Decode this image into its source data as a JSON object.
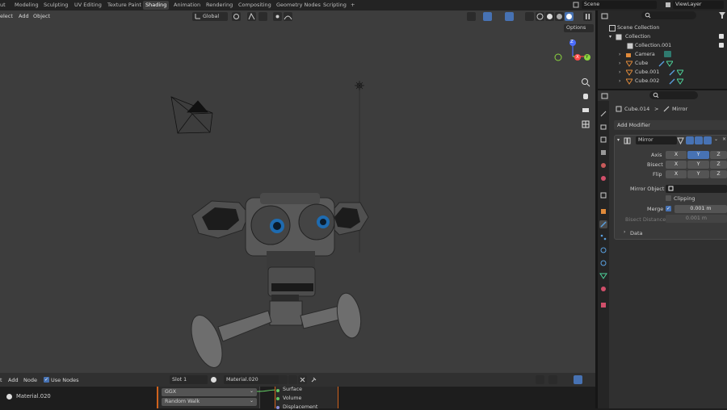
{
  "workspaces": [
    "ut",
    "Modeling",
    "Sculpting",
    "UV Editing",
    "Texture Paint",
    "Shading",
    "Animation",
    "Rendering",
    "Compositing",
    "Geometry Nodes",
    "Scripting",
    "+"
  ],
  "active_workspace": "Shading",
  "scene": "Scene",
  "view_layer": "ViewLayer",
  "viewport": {
    "menu": [
      "elect",
      "Add",
      "Object"
    ],
    "transform_orientation": "Global",
    "options_label": "Options"
  },
  "gizmo": {
    "z": "Z",
    "x": "X",
    "y": "Y"
  },
  "outliner": {
    "rows": [
      {
        "label": "Scene Collection"
      },
      {
        "label": "Collection"
      },
      {
        "label": "Collection.001"
      },
      {
        "label": "Camera"
      },
      {
        "label": "Cube"
      },
      {
        "label": "Cube.001"
      },
      {
        "label": "Cube.002"
      }
    ]
  },
  "properties": {
    "breadcrumb_object": "Cube.014",
    "breadcrumb_sep": ">",
    "breadcrumb_modifier": "Mirror",
    "add_modifier": "Add Modifier",
    "modifier_name": "Mirror",
    "axis_label": "Axis",
    "bisect_label": "Bisect",
    "flip_label": "Flip",
    "x": "X",
    "y": "Y",
    "z": "Z",
    "mirror_object_label": "Mirror Object",
    "clipping_label": "Clipping",
    "merge_label": "Merge",
    "merge_value": "0.001 m",
    "bisect_distance_label": "Bisect Distance",
    "bisect_distance_value": "0.001 m",
    "data_label": "Data"
  },
  "node_editor": {
    "menu": [
      "Add",
      "Node"
    ],
    "use_nodes_label": "Use Nodes",
    "slot": "Slot 1",
    "material": "Material.020",
    "material_left": "Material.020",
    "dropdown1": "GGX",
    "dropdown2": "Random Walk",
    "output_sockets": [
      "Surface",
      "Volume",
      "Displacement"
    ]
  },
  "colors": {
    "accent": "#4772b3",
    "viewport_bg": "#3d3d3d",
    "panel_bg": "#303030",
    "eye_glow": "#2a9df4"
  }
}
